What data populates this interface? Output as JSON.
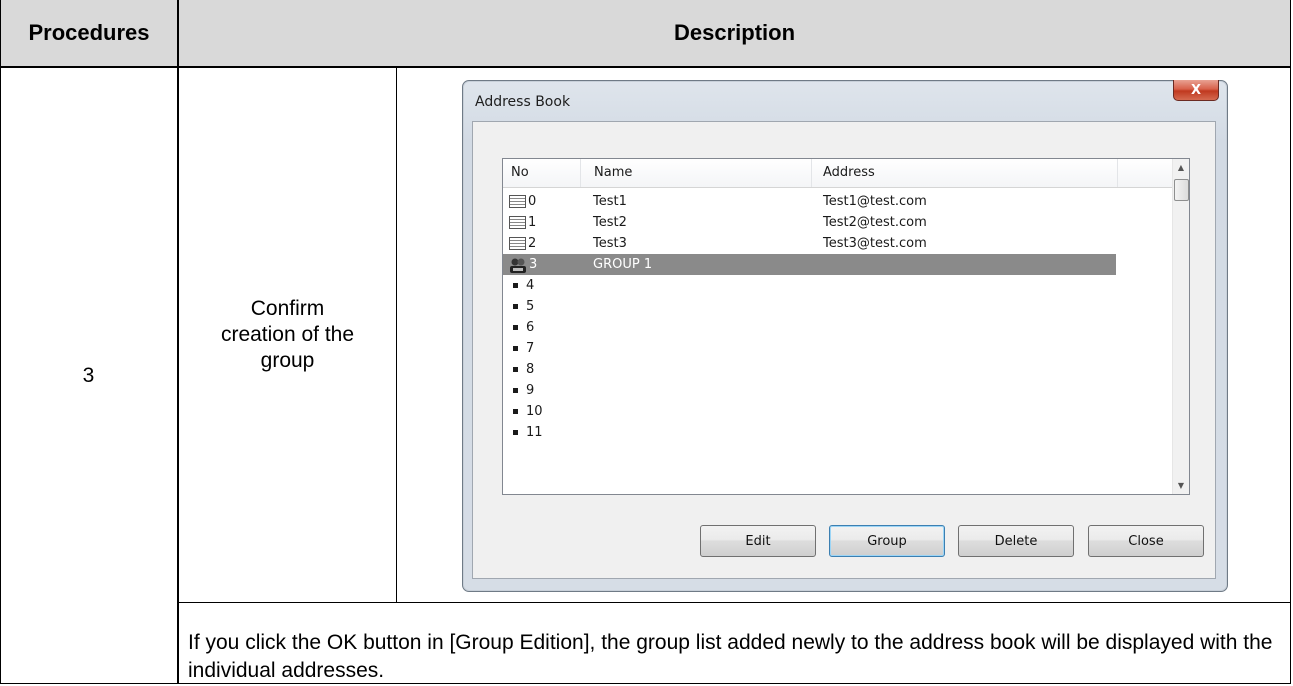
{
  "table": {
    "header_procedures": "Procedures",
    "header_description": "Description",
    "step_number": "3",
    "step_text": "Confirm creation of the group",
    "note": "If you click the OK button in [Group Edition], the group list added newly to the address book will be displayed with the individual addresses."
  },
  "dialog": {
    "title": "Address Book",
    "close_glyph": "X",
    "columns": {
      "no": "No",
      "name": "Name",
      "address": "Address"
    },
    "rows": [
      {
        "no": "0",
        "name": "Test1",
        "address": "Test1@test.com",
        "icon": "address-card-icon"
      },
      {
        "no": "1",
        "name": "Test2",
        "address": "Test2@test.com",
        "icon": "address-card-icon"
      },
      {
        "no": "2",
        "name": "Test3",
        "address": "Test3@test.com",
        "icon": "address-card-icon"
      },
      {
        "no": "3",
        "name": "GROUP 1",
        "address": "",
        "icon": "group-icon",
        "selected": true
      },
      {
        "no": "4",
        "name": "",
        "address": "",
        "icon": "bullet"
      },
      {
        "no": "5",
        "name": "",
        "address": "",
        "icon": "bullet"
      },
      {
        "no": "6",
        "name": "",
        "address": "",
        "icon": "bullet"
      },
      {
        "no": "7",
        "name": "",
        "address": "",
        "icon": "bullet"
      },
      {
        "no": "8",
        "name": "",
        "address": "",
        "icon": "bullet"
      },
      {
        "no": "9",
        "name": "",
        "address": "",
        "icon": "bullet"
      },
      {
        "no": "10",
        "name": "",
        "address": "",
        "icon": "bullet"
      },
      {
        "no": "11",
        "name": "",
        "address": "",
        "icon": "bullet"
      }
    ],
    "buttons": {
      "edit": "Edit",
      "group": "Group",
      "delete": "Delete",
      "close": "Close"
    },
    "selection_color": "#8a8a8a"
  }
}
